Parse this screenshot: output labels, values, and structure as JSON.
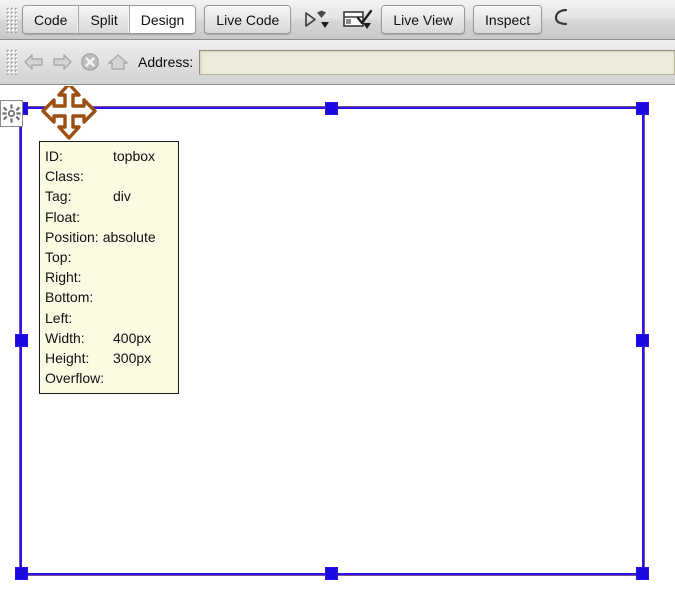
{
  "toolbars": {
    "view_toolbar": {
      "grip_name": "toolbar-grip",
      "view_buttons": [
        {
          "label": "Code",
          "active": false
        },
        {
          "label": "Split",
          "active": false
        },
        {
          "label": "Design",
          "active": true
        }
      ],
      "live_code_label": "Live Code",
      "live_code_icon": "play-arrow-dropdown-icon",
      "inspect_layout_icon": "browser-check-dropdown-icon",
      "live_view_label": "Live View",
      "inspect_label": "Inspect",
      "trailing_icon": "magnet-icon"
    },
    "address_toolbar": {
      "back_icon": "back-arrow-icon",
      "forward_icon": "forward-arrow-icon",
      "stop_icon": "stop-circle-icon",
      "home_icon": "home-icon",
      "address_label": "Address:",
      "address_value": "",
      "address_placeholder": ""
    }
  },
  "canvas": {
    "element_marker_icon": "gear-icon",
    "move_cursor_icon": "move-four-way-icon",
    "selection": {
      "handle_count": 8,
      "border_color": "#2a12e8",
      "handle_color": "#1a09e0"
    }
  },
  "tooltip": {
    "name": "element-property-tooltip",
    "rows": [
      {
        "key": "ID:",
        "value": "topbox"
      },
      {
        "key": "Class:",
        "value": ""
      },
      {
        "key": "Tag:",
        "value": "div"
      },
      {
        "key": "Float:",
        "value": ""
      },
      {
        "key": "Position:",
        "value": "absolute"
      },
      {
        "key": "Top:",
        "value": ""
      },
      {
        "key": "Right:",
        "value": ""
      },
      {
        "key": "Bottom:",
        "value": ""
      },
      {
        "key": "Left:",
        "value": ""
      },
      {
        "key": "Width:",
        "value": "400px"
      },
      {
        "key": "Height:",
        "value": "300px"
      },
      {
        "key": "Overflow:",
        "value": ""
      }
    ]
  }
}
